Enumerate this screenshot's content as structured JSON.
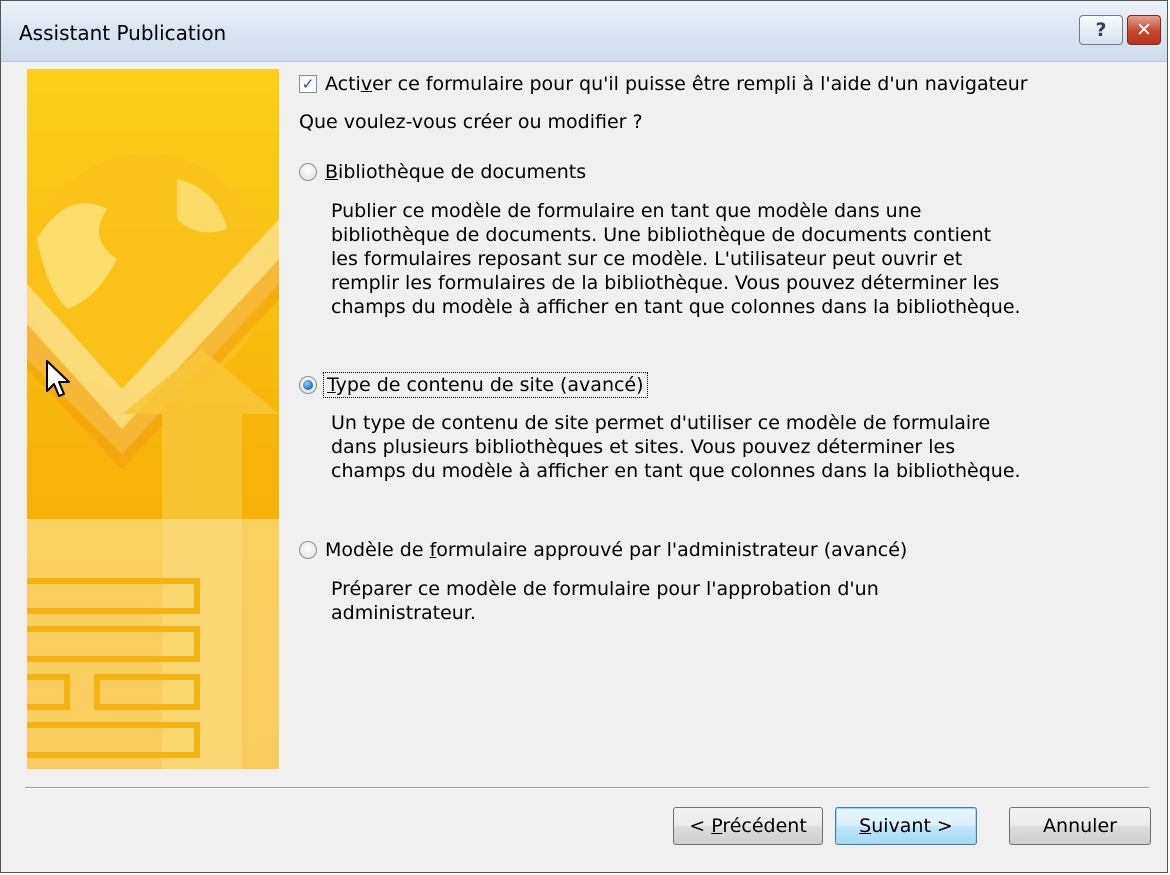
{
  "window": {
    "title": "Assistant Publication"
  },
  "titlebar": {
    "help_label": "?",
    "close_label": "✕"
  },
  "checkbox": {
    "checked": true,
    "label_pre": "Acti",
    "label_mnemonic": "v",
    "label_post": "er ce formulaire pour qu'il puisse être rempli à l'aide d'un navigateur"
  },
  "prompt": "Que voulez-vous créer ou modifier ?",
  "options": [
    {
      "mnemonic": "B",
      "label_rest": "ibliothèque de documents",
      "selected": false,
      "description": "Publier ce modèle de formulaire en tant que modèle dans une bibliothèque de documents. Une bibliothèque de documents contient les formulaires reposant sur ce modèle. L'utilisateur peut ouvrir et remplir les formulaires de la bibliothèque. Vous pouvez déterminer les champs du modèle à afficher en tant que colonnes dans la bibliothèque."
    },
    {
      "mnemonic": "T",
      "label_rest": "ype de contenu de site (avancé)",
      "selected": true,
      "description": "Un type de contenu de site permet d'utiliser ce modèle de formulaire dans plusieurs bibliothèques et sites. Vous pouvez déterminer les champs du modèle à afficher en tant que colonnes dans la bibliothèque."
    },
    {
      "label_pre": "Modèle de ",
      "mnemonic": "f",
      "label_rest": "ormulaire approuvé par l'administrateur (avancé)",
      "selected": false,
      "description": "Préparer ce modèle de formulaire pour l'approbation d'un administrateur."
    }
  ],
  "buttons": {
    "back_pre": "< ",
    "back_mnemonic": "P",
    "back_rest": "récédent",
    "next_mnemonic": "S",
    "next_rest": "uivant >",
    "cancel": "Annuler"
  },
  "colors": {
    "banner_top": "#fbcf1a",
    "banner_bottom": "#f4a906",
    "default_button_border": "#3c7fb1"
  },
  "icons": {
    "banner": "globe-arrow-form-illustration",
    "cursor": "mouse-pointer-icon"
  }
}
